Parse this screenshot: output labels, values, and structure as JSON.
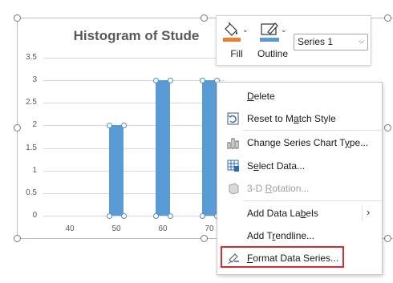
{
  "chart": {
    "title": "Histogram of Stude",
    "y_ticks": [
      "3.5",
      "3",
      "2.5",
      "2",
      "1.5",
      "1",
      "0.5",
      "0"
    ],
    "x_ticks": [
      "40",
      "50",
      "60",
      "70"
    ]
  },
  "chart_data": {
    "type": "bar",
    "title": "Histogram of Stude",
    "categories": [
      "40",
      "50",
      "60",
      "70"
    ],
    "series": [
      {
        "values": [
          0,
          2,
          3,
          3
        ]
      }
    ],
    "ylim": [
      0,
      3.5
    ],
    "grid": true
  },
  "minibar": {
    "fill_label": "Fill",
    "outline_label": "Outline",
    "series_value": "Series 1",
    "fill_color": "#ed7d31",
    "outline_color": "#5b9bd5"
  },
  "menu": {
    "delete": {
      "pre": "",
      "u": "D",
      "post": "elete"
    },
    "reset": {
      "pre": "Reset to M",
      "u": "a",
      "post": "tch Style"
    },
    "change_type": {
      "pre": "Change Series Chart T",
      "u": "y",
      "post": "pe..."
    },
    "select_data": {
      "pre": "S",
      "u": "e",
      "post": "lect Data..."
    },
    "rotation": {
      "pre": "3-D ",
      "u": "R",
      "post": "otation..."
    },
    "data_labels": {
      "pre": "Add Data La",
      "u": "b",
      "post": "els"
    },
    "trendline": {
      "pre": "Add T",
      "u": "r",
      "post": "endline..."
    },
    "format": {
      "pre": "",
      "u": "F",
      "post": "ormat Data Series..."
    }
  },
  "accent": "#5b9bd5",
  "highlight_color": "#d32f2f"
}
